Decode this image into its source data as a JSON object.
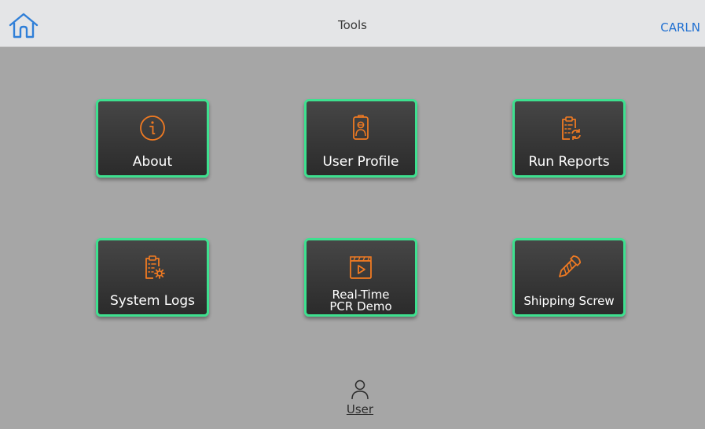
{
  "header": {
    "title": "Tools",
    "user_code": "CARLN",
    "home_icon": "home-icon"
  },
  "accent_colors": {
    "tile_border": "#3ee08f",
    "icon_orange": "#f07a22",
    "link_blue": "#1f6fd1"
  },
  "tiles": [
    {
      "label": "About",
      "icon": "info-icon"
    },
    {
      "label": "User Profile",
      "icon": "id-badge-icon"
    },
    {
      "label": "Run Reports",
      "icon": "clipboard-refresh-icon"
    },
    {
      "label": "System Logs",
      "icon": "clipboard-gear-icon"
    },
    {
      "label_line1": "Real-Time",
      "label_line2": "PCR Demo",
      "icon": "video-play-icon"
    },
    {
      "label": "Shipping Screw",
      "icon": "screw-icon"
    }
  ],
  "footer": {
    "user_label": "User",
    "user_icon": "user-icon"
  }
}
